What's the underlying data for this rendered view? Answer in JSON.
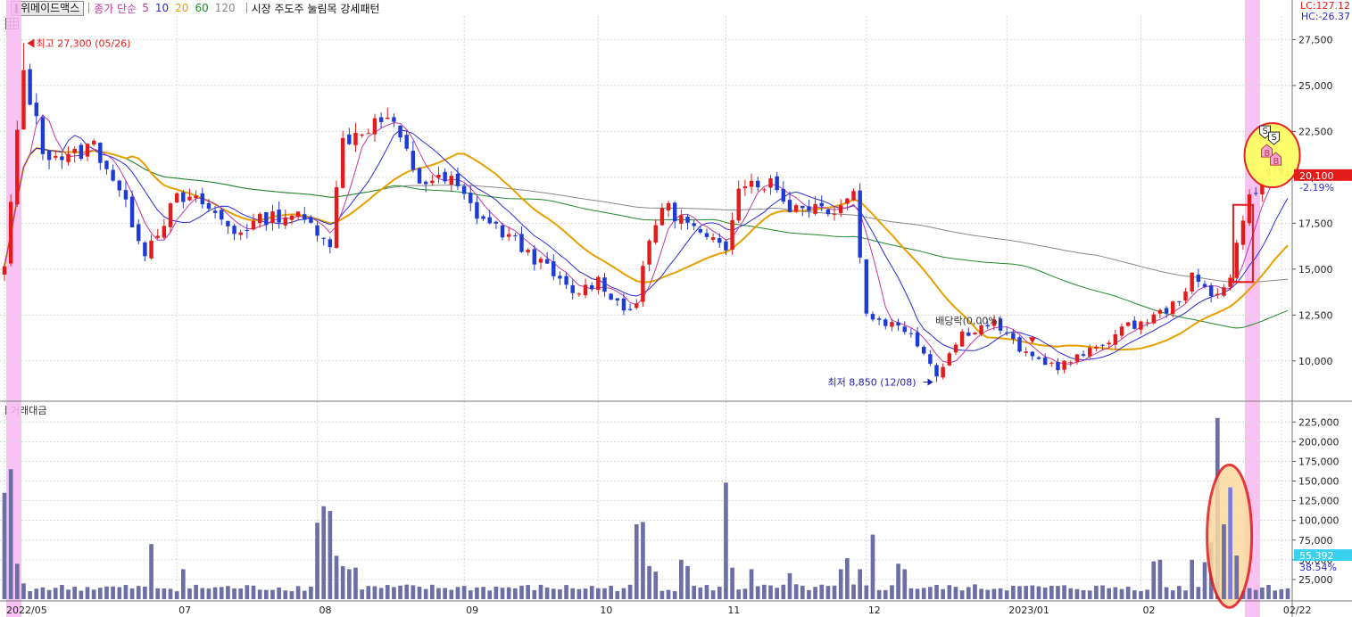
{
  "header": {
    "stock_name": "위메이드맥스",
    "ma_group_label": "종가 단순",
    "ma_periods": [
      {
        "label": "5",
        "color": "#c03aa6"
      },
      {
        "label": "10",
        "color": "#2b2bd6"
      },
      {
        "label": "20",
        "color": "#e8a000"
      },
      {
        "label": "60",
        "color": "#1f8a2a"
      },
      {
        "label": "120",
        "color": "#888888"
      }
    ],
    "pattern_label": "시장 주도주 눌림목 강세패턴"
  },
  "right_labels": {
    "lc": "LC:127.12",
    "hc": "HC:-26.37",
    "last_price": "20,100",
    "last_change": "-2.19%",
    "last_volume": "55,392",
    "volume_pct": "38.54%"
  },
  "volume_title": "거래대금",
  "colors": {
    "up": "#e31b1b",
    "down": "#1f3bd6",
    "volume": "#6c6ea6",
    "highlight": "#f7b8f0",
    "circle_fill": "#ffff66",
    "circle_stroke": "#e31b1b",
    "ma5": "#c03aa6",
    "ma10": "#2b2bd6",
    "ma20": "#e8a000",
    "ma60": "#1f8a2a",
    "ma120": "#888888"
  },
  "annotations": {
    "high": "최고 27,300 (05/26)",
    "low": "최저 8,850 (12/08)",
    "ex_div": "배당락(0,00%)",
    "signal_s": "S",
    "signal_b": "B"
  },
  "chart_data": {
    "type": "candlestick",
    "price_axis": {
      "ticks": [
        10000,
        12500,
        15000,
        17500,
        20000,
        22500,
        25000,
        27500
      ],
      "tick_labels": [
        "10,000",
        "12,500",
        "15,000",
        "17,500",
        "20,000",
        "22,500",
        "25,000",
        "27,500"
      ],
      "range": [
        8000,
        28200
      ]
    },
    "volume_axis": {
      "ticks": [
        25000,
        50000,
        75000,
        100000,
        125000,
        150000,
        175000,
        200000,
        225000
      ],
      "tick_labels": [
        "25,000",
        "50,000",
        "75,000",
        "100,000",
        "125,000",
        "150,000",
        "175,000",
        "200,000",
        "225,000"
      ],
      "range": [
        0,
        240000
      ]
    },
    "x_labels": [
      {
        "label": "2022/05",
        "index": 0
      },
      {
        "label": "07",
        "index": 27
      },
      {
        "label": "08",
        "index": 49
      },
      {
        "label": "09",
        "index": 72
      },
      {
        "label": "10",
        "index": 93
      },
      {
        "label": "11",
        "index": 113
      },
      {
        "label": "12",
        "index": 135
      },
      {
        "label": "2023/01",
        "index": 157
      },
      {
        "label": "02",
        "index": 178
      },
      {
        "label": "02/22",
        "index": 200
      }
    ],
    "high": {
      "value": 27300,
      "date": "05/26"
    },
    "low": {
      "value": 8850,
      "date": "12/08"
    },
    "last": {
      "value": 20100,
      "change_pct": -2.19,
      "volume": 55392
    }
  }
}
